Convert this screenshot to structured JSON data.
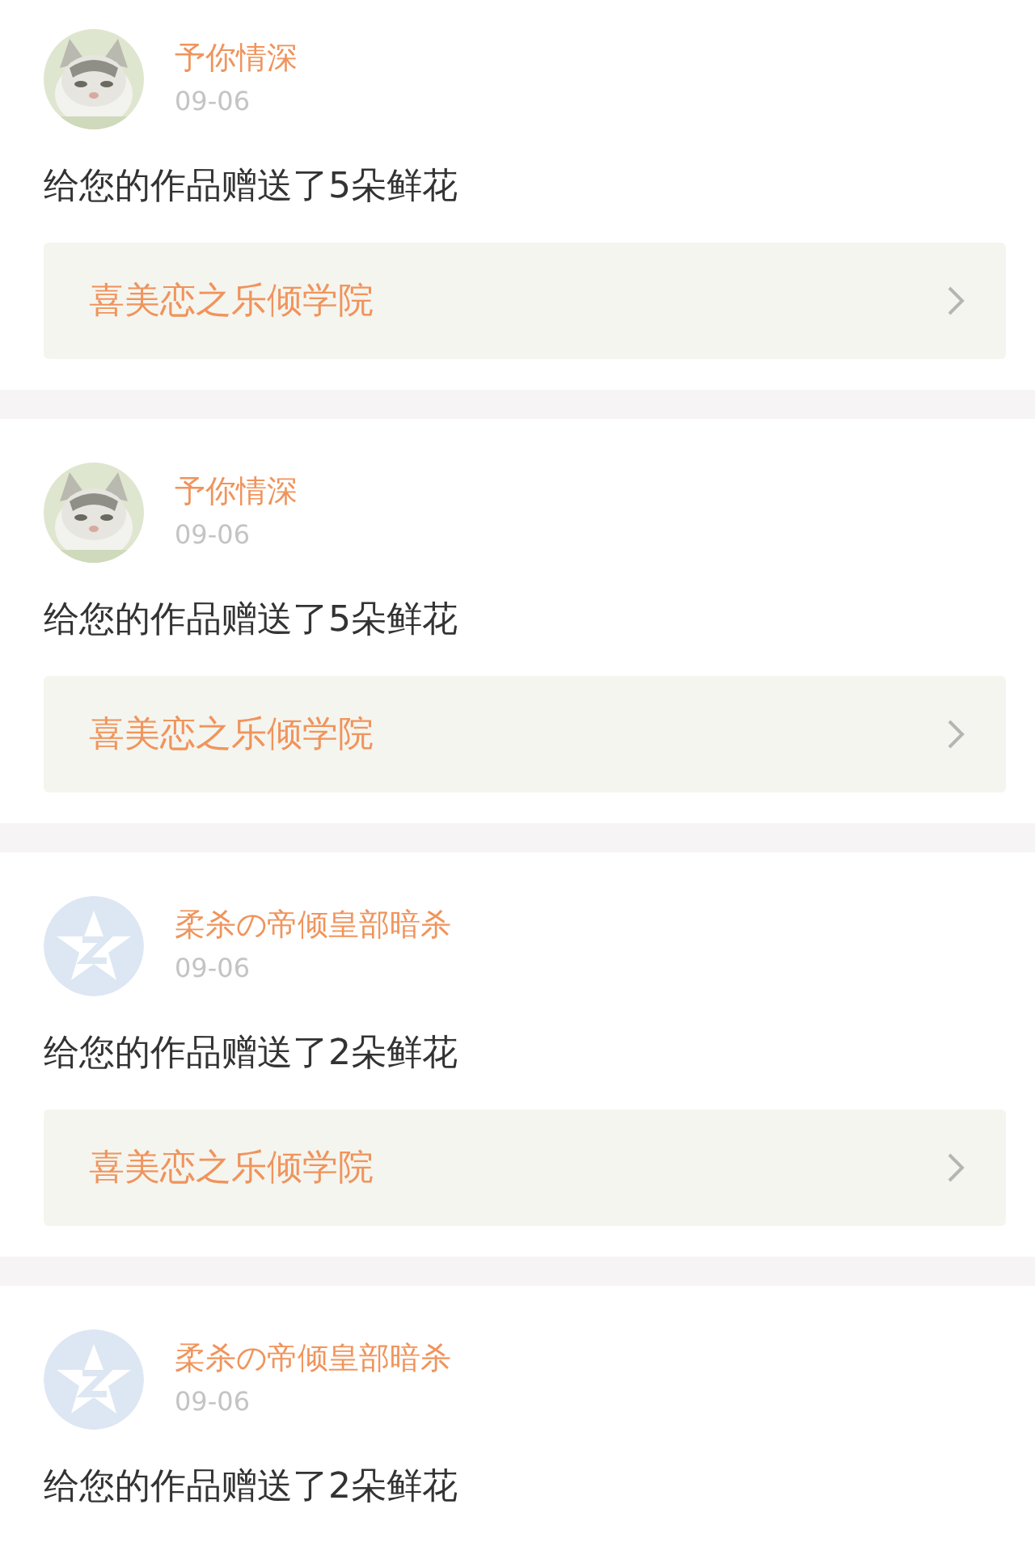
{
  "notifications": [
    {
      "name": "予你情深",
      "date": "09-06",
      "message": "给您的作品赠送了5朵鲜花",
      "link": "喜美恋之乐倾学院"
    },
    {
      "name": "予你情深",
      "date": "09-06",
      "message": "给您的作品赠送了5朵鲜花",
      "link": "喜美恋之乐倾学院"
    },
    {
      "avatar": {
        "kind": "default"
      },
      "name": "柔杀の帝倾皇部暗杀",
      "date": "09-06",
      "message": "给您的作品赠送了2朵鲜花",
      "link": "喜美恋之乐倾学院"
    },
    {
      "avatar": {
        "kind": "default"
      },
      "name": "柔杀の帝倾皇部暗杀",
      "date": "09-06",
      "message": "给您的作品赠送了2朵鲜花"
    }
  ]
}
